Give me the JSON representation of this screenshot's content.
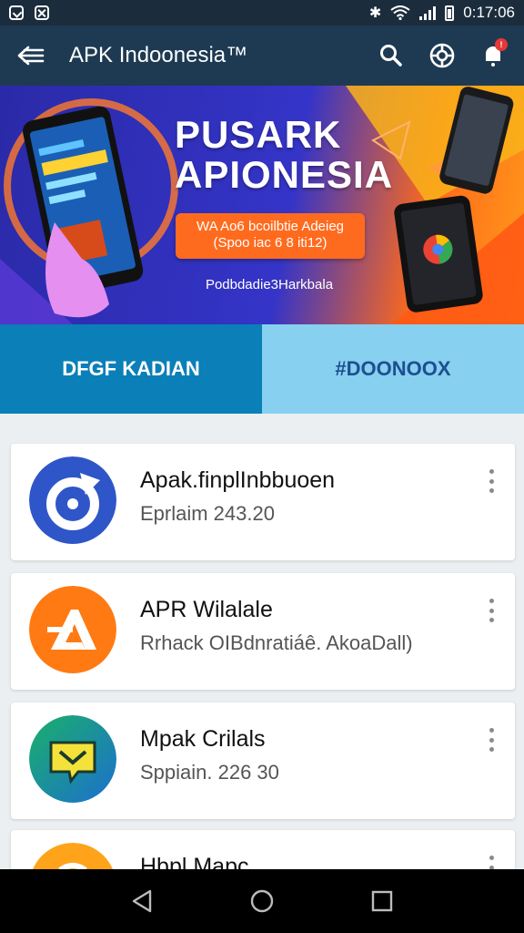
{
  "status_bar": {
    "time": "0:17:06",
    "battery_icon": "battery-icon",
    "wifi_icon": "wifi-icon",
    "signal_icon": "signal-icon"
  },
  "app_bar": {
    "title": "APK Indoonesia™",
    "back_icon": "arrow-left-icon",
    "actions": [
      "search-icon",
      "settings-icon",
      "notification-icon"
    ],
    "badge": "!"
  },
  "banner": {
    "title_line1": "PUSARK",
    "title_line2": "APIONESIA",
    "pill_line1": "WA Ao6 bcoilbtie Adeieg",
    "pill_line2": "(Spoo iac 6 8 iti12)",
    "subtitle": "Podbdadie3Harkbala"
  },
  "tabs": [
    {
      "label": "DFGF KADIAN",
      "active": true
    },
    {
      "label": "#DOONOOX",
      "active": false
    }
  ],
  "apps": [
    {
      "name": "Apak.finplInbbuoen",
      "meta": "Eprlaim 243.20",
      "icon": "compass-icon",
      "color": "#2f56c8"
    },
    {
      "name": "APR Wilalale",
      "meta": "Rrhack OIBdnratiáê. AkoaDall)",
      "icon": "letter-a-icon",
      "color": "#ff7a12"
    },
    {
      "name": "Mpak Crilals",
      "meta": "Sppiain. 226 30",
      "icon": "chat-icon",
      "color": "#1c9e6a"
    },
    {
      "name": "Hbpl Mapc",
      "meta": "",
      "icon": "app-icon",
      "color": "#ffa41a"
    }
  ],
  "nav": [
    "back-triangle-icon",
    "home-circle-icon",
    "recents-square-icon"
  ]
}
